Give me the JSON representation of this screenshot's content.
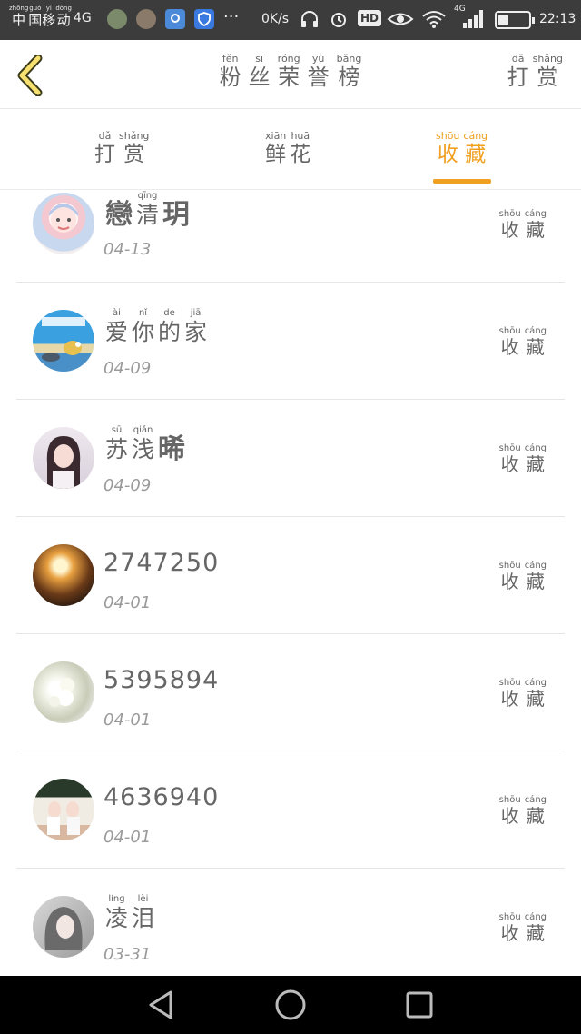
{
  "status_bar": {
    "carrier": [
      {
        "py": "zhōng",
        "ch": "中"
      },
      {
        "py": "guó",
        "ch": "国"
      },
      {
        "py": "yí",
        "ch": "移"
      },
      {
        "py": "dòng",
        "ch": "动"
      }
    ],
    "network": "4G",
    "speed": "0K/s",
    "hd": "HD",
    "signal_label": "4G",
    "battery_level": 0.35,
    "time": "22:13"
  },
  "header": {
    "title": [
      {
        "py": "fěn",
        "ch": "粉"
      },
      {
        "py": "sī",
        "ch": "丝"
      },
      {
        "py": "róng",
        "ch": "荣"
      },
      {
        "py": "yù",
        "ch": "誉"
      },
      {
        "py": "bǎng",
        "ch": "榜"
      }
    ],
    "reward": [
      {
        "py": "dǎ",
        "ch": "打"
      },
      {
        "py": "shǎng",
        "ch": "赏"
      }
    ]
  },
  "tabs": [
    {
      "chars": [
        {
          "py": "dǎ",
          "ch": "打"
        },
        {
          "py": "shǎng",
          "ch": "赏"
        }
      ],
      "active": false
    },
    {
      "chars": [
        {
          "py": "xiān",
          "ch": "鲜"
        },
        {
          "py": "huā",
          "ch": "花"
        }
      ],
      "active": false
    },
    {
      "chars": [
        {
          "py": "shōu",
          "ch": "收"
        },
        {
          "py": "cáng",
          "ch": "藏"
        }
      ],
      "active": true
    }
  ],
  "action": [
    {
      "py": "shōu",
      "ch": "收"
    },
    {
      "py": "cáng",
      "ch": "藏"
    }
  ],
  "list": [
    {
      "name_chars": [
        {
          "py": "",
          "ch": "戀",
          "bold": true
        },
        {
          "py": "qīng",
          "ch": "清"
        },
        {
          "py": "",
          "ch": "玥",
          "bold": true
        }
      ],
      "date": "04-13",
      "avatar": "anime-girl-avatar"
    },
    {
      "name_chars": [
        {
          "py": "ài",
          "ch": "爱"
        },
        {
          "py": "nǐ",
          "ch": "你"
        },
        {
          "py": "de",
          "ch": "的"
        },
        {
          "py": "jiā",
          "ch": "家"
        }
      ],
      "date": "04-09",
      "avatar": "cartoon-beach-avatar"
    },
    {
      "name_chars": [
        {
          "py": "sū",
          "ch": "苏"
        },
        {
          "py": "qiǎn",
          "ch": "浅"
        },
        {
          "py": "",
          "ch": "晞",
          "bold": true
        }
      ],
      "date": "04-09",
      "avatar": "girl-portrait-avatar"
    },
    {
      "name": "2747250",
      "date": "04-01",
      "avatar": "sunset-silhouette-avatar"
    },
    {
      "name": "5395894",
      "date": "04-01",
      "avatar": "white-flowers-avatar"
    },
    {
      "name": "4636940",
      "date": "04-01",
      "avatar": "couple-photo-avatar"
    },
    {
      "name_chars": [
        {
          "py": "líng",
          "ch": "凌"
        },
        {
          "py": "lèi",
          "ch": "泪"
        }
      ],
      "date": "03-31",
      "avatar": "grey-hair-girl-avatar"
    }
  ]
}
